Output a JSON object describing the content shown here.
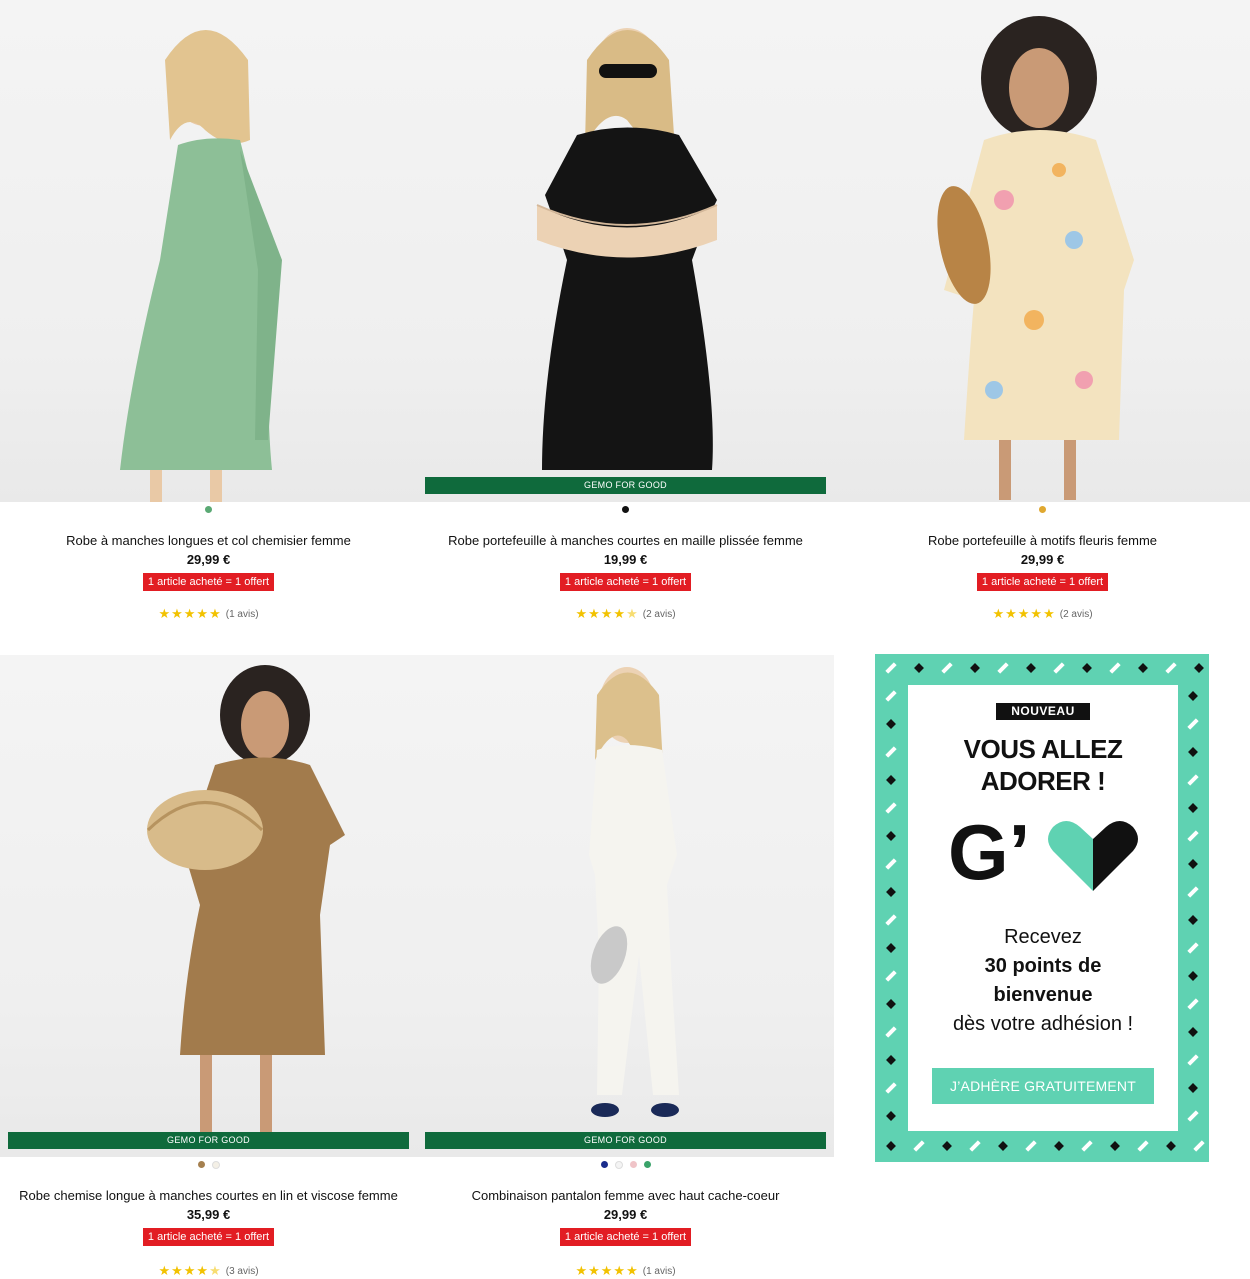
{
  "products": [
    {
      "title": "Robe à manches longues et col chemisier femme",
      "price": "29,99 €",
      "promo": "1 article acheté = 1 offert",
      "rating": 5,
      "reviews": "(1 avis)",
      "badge": "",
      "swatches": [
        "#5aa974"
      ]
    },
    {
      "title": "Robe portefeuille à manches courtes en maille plissée femme",
      "price": "19,99 €",
      "promo": "1 article acheté = 1 offert",
      "rating": 4.5,
      "reviews": "(2 avis)",
      "badge": "GEMO FOR GOOD",
      "swatches": [
        "#111111"
      ]
    },
    {
      "title": "Robe portefeuille à motifs fleuris femme",
      "price": "29,99 €",
      "promo": "1 article acheté = 1 offert",
      "rating": 5,
      "reviews": "(2 avis)",
      "badge": "",
      "swatches": [
        "#e0a830"
      ]
    },
    {
      "title": "Robe chemise longue à manches courtes en lin et viscose femme",
      "price": "35,99 €",
      "promo": "1 article acheté = 1 offert",
      "rating": 4.5,
      "reviews": "(3 avis)",
      "badge": "GEMO FOR GOOD",
      "swatches": [
        "#a5804f",
        "#f4f0e6"
      ]
    },
    {
      "title": "Combinaison pantalon femme avec haut cache-coeur",
      "price": "29,99 €",
      "promo": "1 article acheté = 1 offert",
      "rating": 5,
      "reviews": "(1 avis)",
      "badge": "GEMO FOR GOOD",
      "swatches": [
        "#1a2c8c",
        "#f4f4f4",
        "#f0c4c8",
        "#3aa36a"
      ]
    }
  ],
  "loyalty": {
    "tag": "NOUVEAU",
    "headline_1": "VOUS ALLEZ",
    "headline_2": "ADORER !",
    "logo_letter": "G’",
    "line_1": "Recevez",
    "line_2": "30 points de",
    "line_3": "bienvenue",
    "line_4": "dès votre adhésion !",
    "cta": "J’ADHÈRE GRATUITEMENT",
    "accent": "#5fd2b2"
  },
  "colors": {
    "promo_red": "#e21d23",
    "badge_green": "#0f6a3c",
    "star_yellow": "#f2c200"
  }
}
